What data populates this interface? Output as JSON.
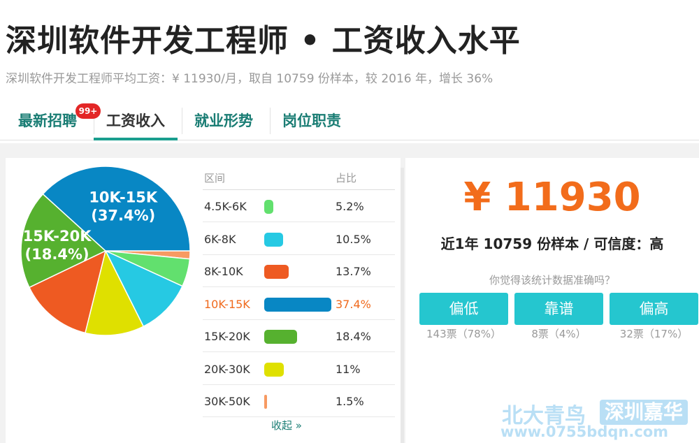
{
  "title": "深圳软件开发工程师 • 工资收入水平",
  "subtitle": "深圳软件开发工程师平均工资：¥ 11930/月，取自 10759 份样本，较 2016 年，增长 36%",
  "tabs": [
    {
      "label": "最新招聘",
      "badge": "99+"
    },
    {
      "label": "工资收入"
    },
    {
      "label": "就业形势"
    },
    {
      "label": "岗位职责"
    }
  ],
  "table": {
    "col_range": "区间",
    "col_pct": "占比",
    "collapse": "收起 »"
  },
  "chart_data": {
    "type": "pie",
    "categories": [
      "4.5K-6K",
      "6K-8K",
      "8K-10K",
      "10K-15K",
      "15K-20K",
      "20K-30K",
      "30K-50K"
    ],
    "values": [
      5.2,
      10.5,
      13.7,
      37.4,
      18.4,
      11,
      1.5
    ],
    "value_labels": [
      "5.2%",
      "10.5%",
      "13.7%",
      "37.4%",
      "18.4%",
      "11%",
      "1.5%"
    ],
    "colors": [
      "#62e06e",
      "#26c9e3",
      "#ee5a22",
      "#0887c4",
      "#56b12f",
      "#dfe000",
      "#f79a62"
    ],
    "highlight": "10K-15K",
    "slice_labels": {
      "10K-15K": [
        "10K-15K",
        "(37.4%)"
      ],
      "15K-20K": [
        "15K-20K",
        "(18.4%)"
      ]
    }
  },
  "summary": {
    "price": "¥ 11930",
    "sample_text": "近1年 10759 份样本 / 可信度：高",
    "question": "你觉得该统计数据准确吗？"
  },
  "votes": [
    {
      "label": "偏低",
      "count": "143票（78%）"
    },
    {
      "label": "靠谱",
      "count": "8票（4%）"
    },
    {
      "label": "偏高",
      "count": "32票（17%）"
    }
  ],
  "watermark": {
    "brand": "北大青鸟",
    "box": "深圳嘉华",
    "url": "www.0755bdqn.com"
  }
}
